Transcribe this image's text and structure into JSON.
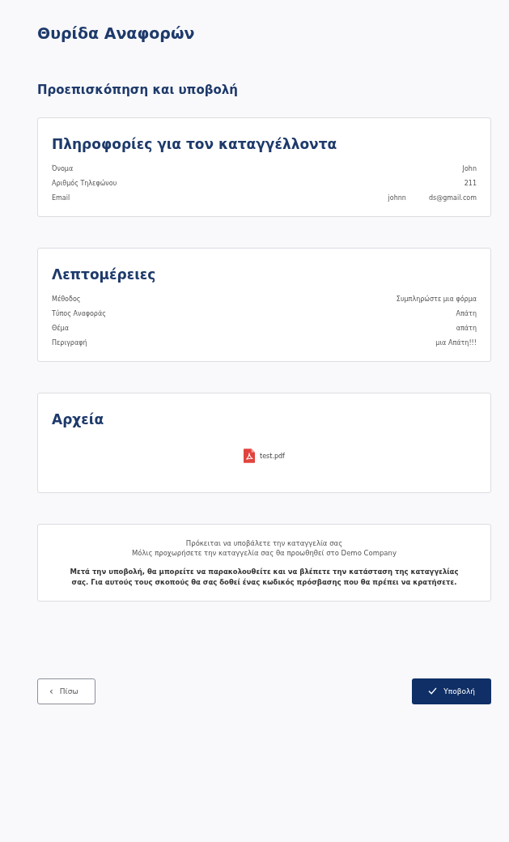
{
  "title": "Θυρίδα Αναφορών",
  "subtitle": "Προεπισκόπηση και υποβολή",
  "sections": [
    {
      "kind": "fields",
      "title": "Πληροφορίες για τον καταγγέλλοντα",
      "fields": [
        {
          "label": "Όνομα",
          "value": [
            "John"
          ]
        },
        {
          "label": "Αριθμός Τηλεφώνου",
          "value": [
            "211"
          ]
        },
        {
          "label": "Email",
          "value": [
            "johnn",
            "ds@gmail.com"
          ]
        }
      ]
    },
    {
      "kind": "fields",
      "title": "Λεπτομέρειες",
      "fields": [
        {
          "label": "Μέθοδος",
          "value": [
            "Συμπληρώστε μια φόρμα"
          ]
        },
        {
          "label": "Τύπος Αναφοράς",
          "value": [
            "Απάτη"
          ]
        },
        {
          "label": "Θέμα",
          "value": [
            "απάτη"
          ]
        },
        {
          "label": "Περιγραφή",
          "value": [
            "μια Απάτη!!!"
          ]
        }
      ]
    },
    {
      "kind": "files",
      "title": "Αρχεία",
      "files": [
        {
          "name": "test.pdf"
        }
      ]
    }
  ],
  "notice": {
    "lines": [
      "Πρόκειται να υποβάλετε την καταγγελία σας",
      "Μόλις προχωρήσετε την καταγγελία σας θα προωθηθεί στο Demo Company"
    ],
    "bold": "Μετά την υποβολή, θα μπορείτε να παρακολουθείτε και να βλέπετε την κατάσταση της καταγγελίας σας. Για αυτούς τους σκοπούς θα σας δοθεί ένας κωδικός πρόσβασης που θα πρέπει να κρατήσετε."
  },
  "buttons": {
    "back": {
      "label": "Πίσω",
      "icon": "‹"
    },
    "submit": {
      "label": "Υποβολή"
    }
  }
}
